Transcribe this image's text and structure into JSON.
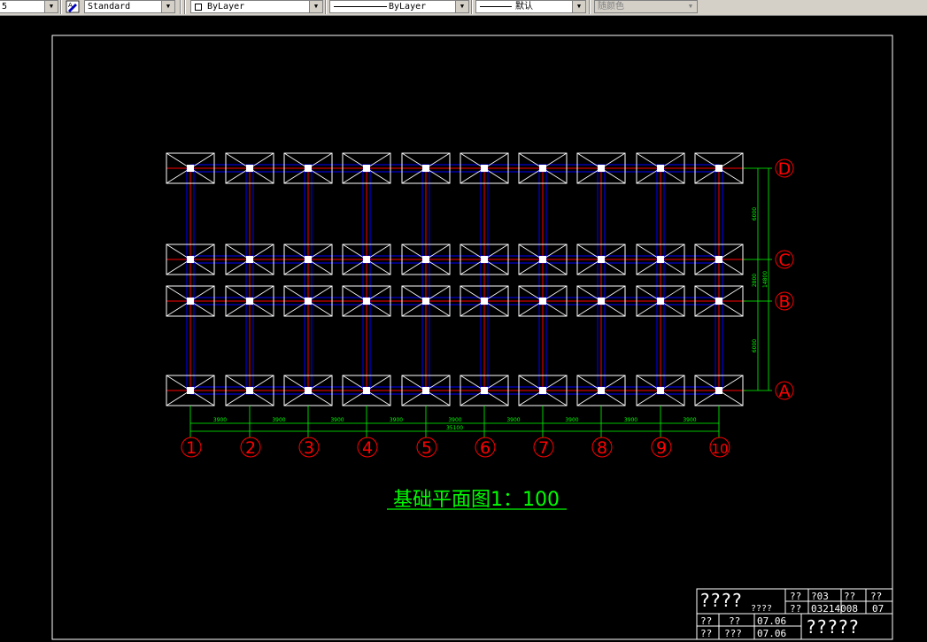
{
  "toolbar": {
    "layer_combo": "5",
    "textstyle_icon": "text-style-icon",
    "textstyle_combo": "Standard",
    "layer_color_combo": "ByLayer",
    "linetype_combo": "ByLayer",
    "lineweight_combo": "默认",
    "plotstyle_combo": "随颜色"
  },
  "colors": {
    "background": "#000000",
    "border": "#ffffff",
    "grid_red": "#ff0000",
    "grid_blue": "#0000ff",
    "dim_green": "#00ff00",
    "footing": "#ffffff",
    "title_green": "#00ff00"
  },
  "plan": {
    "title": "基础平面图1：100",
    "column_axes": [
      "1",
      "2",
      "3",
      "4",
      "5",
      "6",
      "7",
      "8",
      "9",
      "10"
    ],
    "row_axes": [
      "D",
      "C",
      "B",
      "A"
    ],
    "bay_dims": [
      "3900",
      "3900",
      "3900",
      "3900",
      "3900",
      "3900",
      "3900",
      "3900",
      "3900"
    ],
    "total_width": "35100",
    "row_dims": [
      "6000",
      "2800",
      "6000"
    ],
    "total_depth": "14800"
  },
  "title_block": {
    "school": "????",
    "dept": "????",
    "r1c1": "??",
    "r1c2": "?03",
    "r1c3": "??",
    "r1c4": "??",
    "r2c1": "??",
    "r2c2": "03214008",
    "r2c3": "07",
    "r3c1": "??",
    "r3c2": "??",
    "r3c3": "07.06",
    "r4c1": "??",
    "r4c2": "???",
    "r4c3": "07.06",
    "drawing_name": "?????"
  }
}
